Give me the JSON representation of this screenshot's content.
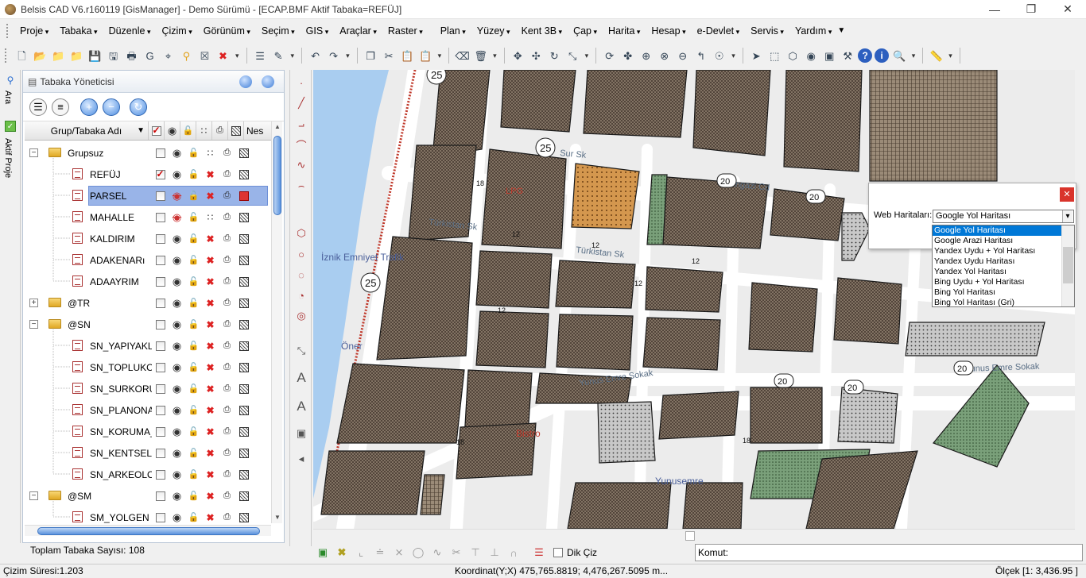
{
  "window": {
    "title": "Belsis CAD V6.r160119 [GisManager] - Demo Sürümü - [ECAP.BMF  Aktif Tabaka=REFÜJ]",
    "minimize": "—",
    "restore": "❐",
    "close": "✕"
  },
  "menu": {
    "items": [
      "Proje",
      "Tabaka",
      "Düzenle",
      "Çizim",
      "Görünüm",
      "Seçim",
      "GIS",
      "Araçlar",
      "Raster"
    ],
    "items2": [
      "Plan",
      "Yüzey",
      "Kent 3B",
      "Çap",
      "Harita",
      "Hesap",
      "e-Devlet",
      "Servis",
      "Yardım"
    ]
  },
  "toolbar": {
    "icons": [
      "new-file-icon",
      "open-folder-icon",
      "open-icon",
      "add-folder-icon",
      "save-icon",
      "save-as-icon",
      "print-icon",
      "google-icon",
      "target-icon",
      "marker-icon",
      "map-icon",
      "cancel-icon"
    ],
    "icons2": [
      "layers-icon",
      "edit-layer-icon"
    ],
    "icons3": [
      "undo-icon",
      "redo-icon"
    ],
    "icons4": [
      "copy-icon",
      "cut-icon",
      "paste-icon",
      "paste-special-icon"
    ],
    "icons5": [
      "erase-icon",
      "trash-icon"
    ],
    "icons6": [
      "move-icon",
      "move-copy-icon",
      "rotate-icon",
      "scale-icon"
    ],
    "icons7": [
      "refresh-icon",
      "pan-icon",
      "zoom-in-icon",
      "zoom-window-icon",
      "zoom-out-icon",
      "zoom-previous-icon",
      "zoom-all-icon"
    ],
    "icons8": [
      "select-icon",
      "select-window-icon",
      "select-polygon-icon",
      "select-point-icon",
      "select-box-icon",
      "properties-icon",
      "help-icon",
      "info-icon",
      "find-icon"
    ],
    "icons9": [
      "ruler-icon"
    ]
  },
  "leftstrip": {
    "search_tab": "Ara",
    "project_tab": "Aktif Proje"
  },
  "layer_panel": {
    "title": "Tabaka Yöneticisi",
    "column_name": "Grup/Tabaka Adı",
    "column_last": "Nes",
    "footer": "Toplam Tabaka Sayısı: 108",
    "rows": [
      {
        "name": "Grupsuz",
        "type": "group",
        "level": 0,
        "expanded": true,
        "visible": true,
        "snap": false,
        "selected": false
      },
      {
        "name": "REFÜJ",
        "type": "layer",
        "level": 1,
        "checked": true,
        "visible": true,
        "snap": true,
        "selected": false
      },
      {
        "name": "PARSEL",
        "type": "layer",
        "level": 1,
        "checked": false,
        "visible": false,
        "snap": true,
        "selected": true,
        "fill_red": true
      },
      {
        "name": "MAHALLE",
        "type": "layer",
        "level": 1,
        "checked": false,
        "visible": false,
        "snap": false,
        "selected": false
      },
      {
        "name": "KALDIRIM",
        "type": "layer",
        "level": 1,
        "checked": false,
        "visible": true,
        "snap": true,
        "selected": false
      },
      {
        "name": "ADAKENARı",
        "type": "layer",
        "level": 1,
        "checked": false,
        "visible": true,
        "snap": true,
        "selected": false
      },
      {
        "name": "ADAAYRIM",
        "type": "layer",
        "level": 1,
        "checked": false,
        "visible": true,
        "snap": true,
        "selected": false
      },
      {
        "name": "@TR",
        "type": "group",
        "level": 0,
        "expanded": false,
        "visible": true,
        "snap": true,
        "selected": false
      },
      {
        "name": "@SN",
        "type": "group",
        "level": 0,
        "expanded": true,
        "visible": true,
        "snap": true,
        "selected": false
      },
      {
        "name": "SN_YAPIYAKLA",
        "type": "layer",
        "level": 1,
        "checked": false,
        "visible": true,
        "snap": true,
        "selected": false
      },
      {
        "name": "SN_TOPLUKON",
        "type": "layer",
        "level": 1,
        "checked": false,
        "visible": true,
        "snap": true,
        "selected": false
      },
      {
        "name": "SN_SURKORU",
        "type": "layer",
        "level": 1,
        "checked": false,
        "visible": true,
        "snap": true,
        "selected": false
      },
      {
        "name": "SN_PLANONAI",
        "type": "layer",
        "level": 1,
        "checked": false,
        "visible": true,
        "snap": true,
        "selected": false
      },
      {
        "name": "SN_KORUMA_",
        "type": "layer",
        "level": 1,
        "checked": false,
        "visible": true,
        "snap": true,
        "selected": false
      },
      {
        "name": "SN_KENTSELS",
        "type": "layer",
        "level": 1,
        "checked": false,
        "visible": true,
        "snap": true,
        "selected": false
      },
      {
        "name": "SN_ARKEOLO.",
        "type": "layer",
        "level": 1,
        "checked": false,
        "visible": true,
        "snap": true,
        "selected": false
      },
      {
        "name": "@SM",
        "type": "group",
        "level": 0,
        "expanded": true,
        "visible": true,
        "snap": true,
        "selected": false
      },
      {
        "name": "SM_YOLGEN",
        "type": "layer",
        "level": 1,
        "checked": false,
        "visible": true,
        "snap": true,
        "selected": false
      }
    ]
  },
  "map": {
    "streets": [
      "Sur Sk",
      "Yangazi Cd",
      "Türkistan Sk",
      "Türkistan Sk",
      "Yunus Emre Sokak",
      "Yunus Emre Sokak"
    ],
    "places": [
      "İznik Emniyet Trafik",
      "Öner",
      "Bistro",
      "Yunusemre"
    ],
    "speed_labels": [
      "25",
      "25",
      "25"
    ],
    "road_numbers": [
      "20",
      "20",
      "20",
      "20",
      "20"
    ],
    "stub_labels": [
      "18",
      "18",
      "18",
      "12",
      "12",
      "12",
      "12",
      "12"
    ],
    "zoom_tag": "LPG",
    "colors": {
      "background": "#ececec",
      "block": "#6f5f50",
      "block_light": "#a89a88",
      "road": "#ffffff",
      "water": "#a9cdf0",
      "green": "#7aa07a",
      "orange": "#d4974e"
    }
  },
  "web_maps": {
    "label": "Web Haritaları:",
    "selected": "Google Yol Haritası",
    "options": [
      "Google Yol Haritası",
      "Google Arazi Haritası",
      "Yandex Uydu + Yol Haritası",
      "Yandex Uydu Haritası",
      "Yandex Yol Haritası",
      "Bing Uydu + Yol Haritası",
      "Bing Yol Haritası",
      "Bing Yol Haritası (Gri)"
    ]
  },
  "command": {
    "dik_ciz": "Dik Çiz",
    "prompt": "Komut:"
  },
  "status": {
    "draw_time": "Çizim Süresi:1.203",
    "coordinate": "Koordinat(Y;X)  475,765.8819; 4,476,267.5095 m...",
    "scale": "Ölçek [1: 3,436.95 ]"
  }
}
